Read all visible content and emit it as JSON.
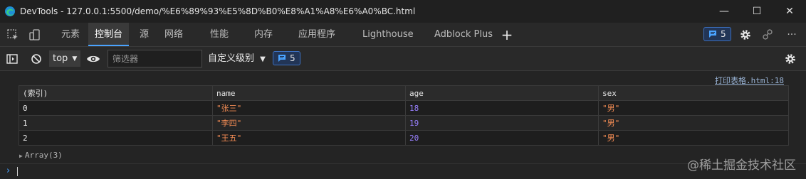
{
  "window": {
    "title": "DevTools - 127.0.0.1:5500/demo/%E6%89%93%E5%8D%B0%E8%A1%A8%E6%A0%BC.html",
    "minimize_glyph": "—",
    "maximize_glyph": "☐",
    "close_glyph": "✕"
  },
  "tabs": [
    {
      "label": "元素"
    },
    {
      "label": "控制台"
    },
    {
      "label": "源"
    },
    {
      "label": "网络"
    },
    {
      "label": "性能"
    },
    {
      "label": "内存"
    },
    {
      "label": "应用程序"
    },
    {
      "label": "Lighthouse"
    },
    {
      "label": "Adblock Plus"
    }
  ],
  "active_tab": "控制台",
  "tabbar": {
    "add_tab_glyph": "+",
    "issues_count": "5",
    "more_glyph": "···"
  },
  "toolbar": {
    "context": "top",
    "filter_placeholder": "筛选器",
    "levels_label": "自定义级别",
    "levels_arrow": "▼",
    "message_count": "5"
  },
  "console": {
    "source_link": "打印表格.html:18",
    "table": {
      "headers": [
        "(索引)",
        "name",
        "age",
        "sex"
      ],
      "rows": [
        {
          "index": "0",
          "name": "\"张三\"",
          "age": "18",
          "sex": "\"男\""
        },
        {
          "index": "1",
          "name": "\"李四\"",
          "age": "19",
          "sex": "\"男\""
        },
        {
          "index": "2",
          "name": "\"王五\"",
          "age": "20",
          "sex": "\"男\""
        }
      ]
    },
    "array_summary": "Array(3)",
    "expand_glyph": "▶",
    "prompt_glyph": "›"
  },
  "watermark": "@稀土掘金技术社区",
  "colors": {
    "accent": "#4aa3ff",
    "string_value": "#f28b54",
    "number_value": "#9980ff"
  }
}
